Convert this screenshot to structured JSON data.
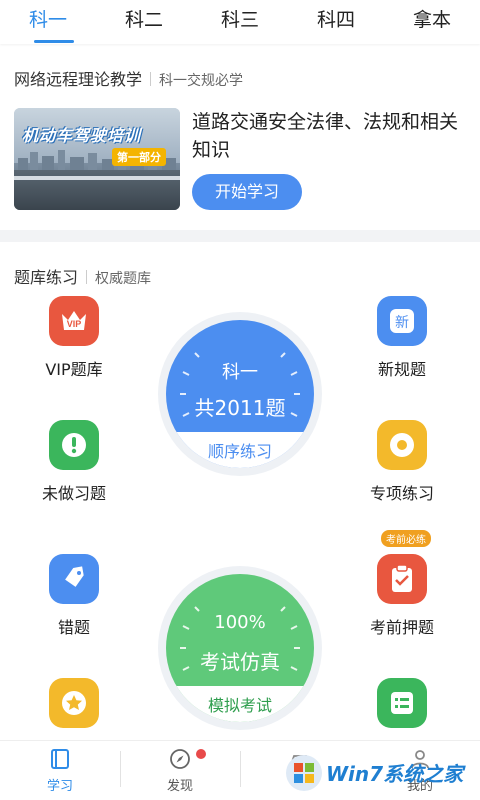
{
  "tabs": [
    {
      "label": "科一",
      "active": true
    },
    {
      "label": "科二",
      "active": false
    },
    {
      "label": "科三",
      "active": false
    },
    {
      "label": "科四",
      "active": false
    },
    {
      "label": "拿本",
      "active": false
    }
  ],
  "course": {
    "header_title": "网络远程理论教学",
    "header_sub": "科一交规必学",
    "banner_title": "机动车驾驶培训",
    "banner_part": "第一部分",
    "title": "道路交通安全法律、法规和相关知识",
    "start_label": "开始学习"
  },
  "practice": {
    "header_title": "题库练习",
    "header_sub": "权威题库",
    "items": {
      "vip": {
        "label": "VIP题库",
        "icon": "crown-vip-icon",
        "icon_text": "VIP",
        "color": "#e8573f"
      },
      "new_rules": {
        "label": "新规题",
        "icon": "new-badge-icon",
        "icon_text": "新",
        "color": "#4c8ef0"
      },
      "undone": {
        "label": "未做习题",
        "icon": "exclamation-icon",
        "color": "#3bb65c"
      },
      "special": {
        "label": "专项练习",
        "icon": "target-icon",
        "color": "#f3b92b"
      },
      "wrong": {
        "label": "错题",
        "icon": "tag-icon",
        "color": "#4c8ef0"
      },
      "pre_exam": {
        "label": "考前押题",
        "icon": "clipboard-check-icon",
        "color": "#e8573f",
        "badge": "考前必练"
      },
      "favorite": {
        "label": "",
        "icon": "star-icon",
        "color": "#f3b92b"
      },
      "list": {
        "label": "",
        "icon": "list-icon",
        "color": "#3bb65c"
      }
    },
    "dial_sequence": {
      "top": "科一",
      "middle": "共2011题",
      "bottom": "顺序练习",
      "color": "#4c8ef0"
    },
    "dial_exam": {
      "top": "100%",
      "middle": "考试仿真",
      "bottom": "模拟考试",
      "color": "#5fc97a"
    }
  },
  "nav": [
    {
      "label": "学习",
      "icon": "book-icon",
      "active": true
    },
    {
      "label": "发现",
      "icon": "compass-icon",
      "active": false,
      "dot": true
    },
    {
      "label": "",
      "icon": "car-icon",
      "active": false
    },
    {
      "label": "我的",
      "icon": "user-icon",
      "active": false
    }
  ],
  "watermark": {
    "text": "Win7系统之家"
  }
}
